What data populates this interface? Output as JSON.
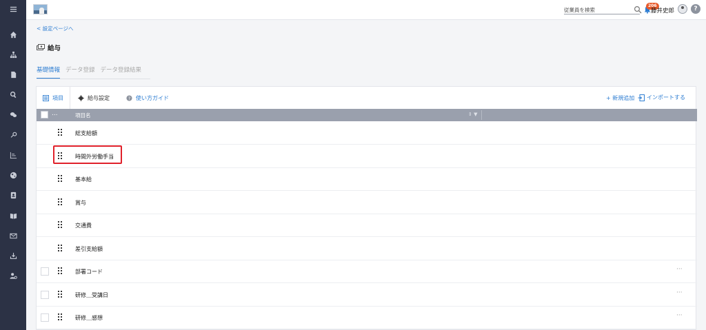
{
  "header": {
    "search_placeholder": "従業員を検索",
    "notification_count": "206",
    "user_name": "藤井史郎",
    "help_symbol": "?"
  },
  "breadcrumb": {
    "back_label": "< 設定ページへ"
  },
  "page": {
    "title": "給与"
  },
  "top_tabs": [
    {
      "label": "基礎情報",
      "active": true
    },
    {
      "label": "データ登録",
      "active": false
    },
    {
      "label": "データ登録結果",
      "active": false
    }
  ],
  "card_tabs": {
    "items_label": "項目",
    "salary_settings_label": "給与設定",
    "guide_label": "使い方ガイド",
    "add_new_label": "+ 新規追加",
    "import_label": "インポートする"
  },
  "table": {
    "select_menu": "...",
    "column_name": "項目名",
    "sort_filter": "⇕ ▼",
    "rows": [
      {
        "name": "総支給額",
        "checkbox": false,
        "more": ""
      },
      {
        "name": "時間外労働手当",
        "checkbox": false,
        "more": "",
        "highlighted": true
      },
      {
        "name": "基本給",
        "checkbox": false,
        "more": ""
      },
      {
        "name": "賞与",
        "checkbox": false,
        "more": ""
      },
      {
        "name": "交通費",
        "checkbox": false,
        "more": ""
      },
      {
        "name": "差引支給額",
        "checkbox": false,
        "more": ""
      },
      {
        "name": "部署コード",
        "checkbox": true,
        "more": "···"
      },
      {
        "name": "研修＿受講日",
        "checkbox": true,
        "more": "···"
      },
      {
        "name": "研修＿感想",
        "checkbox": true,
        "more": "···"
      }
    ]
  },
  "colors": {
    "sidebar_bg": "#2c3245",
    "accent": "#2d7dd2",
    "table_header": "#9aa0ad",
    "highlight_border": "#e0202a",
    "badge": "#e85a2a"
  }
}
